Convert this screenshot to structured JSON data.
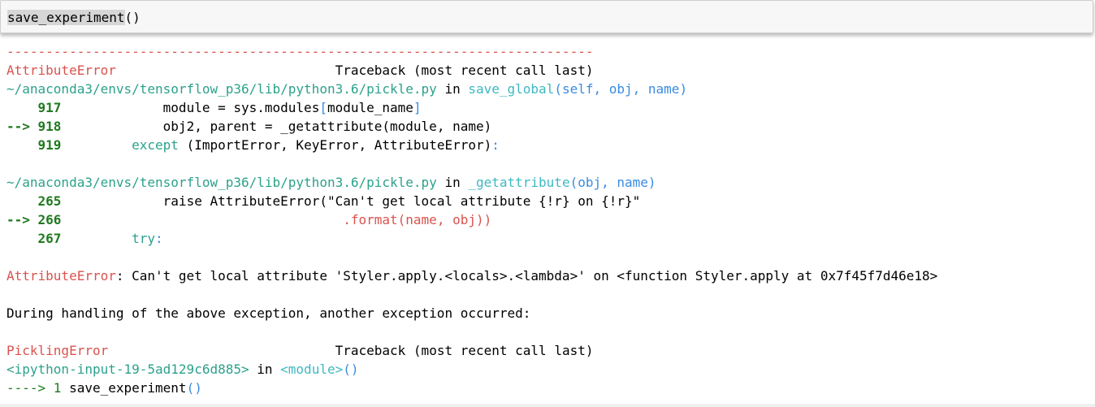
{
  "input_cell": {
    "fn_name": "save_experiment",
    "parens": "()"
  },
  "output": {
    "dash_line": "---------------------------------------------------------------------------",
    "err1_name": "AttributeError",
    "tb_pad": "                            ",
    "tb_label": "Traceback (most recent call last)",
    "frame1": {
      "path": "~/anaconda3/envs/tensorflow_p36/lib/python3.6/pickle.py",
      "in": " in ",
      "func": "save_global",
      "args": "(self, obj, name)",
      "lines": [
        {
          "prefix": "    ",
          "num": "917",
          "code_a": "             module = sys.modules",
          "br_open": "[",
          "code_b": "module_name",
          "br_close": "]"
        },
        {
          "prefix": "--> ",
          "num": "918",
          "code": "             obj2, parent = _getattribute(module, name)"
        },
        {
          "prefix": "    ",
          "num": "919",
          "code_kw": "         except",
          "code_b": " (ImportError, KeyError, AttributeError)",
          "code_c": ":"
        }
      ]
    },
    "frame2": {
      "path": "~/anaconda3/envs/tensorflow_p36/lib/python3.6/pickle.py",
      "in": " in ",
      "func": "_getattribute",
      "args": "(obj, name)",
      "lines": [
        {
          "prefix": "    ",
          "num": "265",
          "code": "             raise AttributeError(\"Can't get local attribute {!r} on {!r}\""
        },
        {
          "prefix": "--> ",
          "num": "266",
          "code_pad": "                                    ",
          "code": ".format(name, obj))"
        },
        {
          "prefix": "    ",
          "num": "267",
          "code_kw": "         try",
          "code_c": ":"
        }
      ]
    },
    "err1_msg_name": "AttributeError",
    "err1_msg": ": Can't get local attribute 'Styler.apply.<locals>.<lambda>' on <function Styler.apply at 0x7f45f7d46e18>",
    "during": "During handling of the above exception, another exception occurred:",
    "err2_name": "PicklingError",
    "tb_pad2": "                             ",
    "frame3": {
      "path": "<ipython-input-19-5ad129c6d885>",
      "in": " in ",
      "func": "<module>",
      "args": "()"
    },
    "last_line": {
      "arrow": "----> 1 ",
      "code": "save_experiment",
      "parens": "()"
    }
  }
}
